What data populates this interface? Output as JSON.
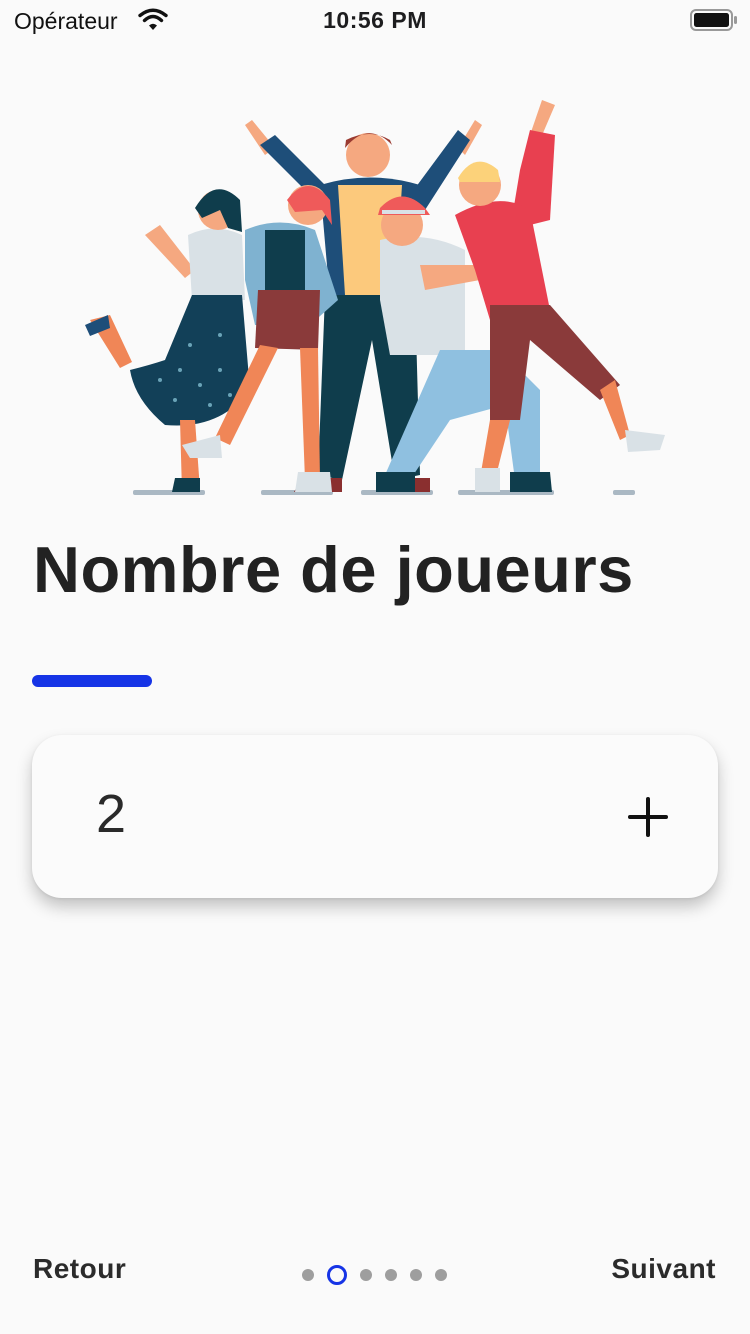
{
  "status_bar": {
    "carrier": "Opérateur",
    "time": "10:56 PM",
    "icons": [
      "wifi-icon",
      "battery-icon"
    ]
  },
  "hero": {
    "illustration": "group-of-friends-celebrating-illustration"
  },
  "page": {
    "title": "Nombre de joueurs",
    "accent_color": "#1634e6"
  },
  "stepper": {
    "value": "2",
    "increment_icon": "plus-icon"
  },
  "footer": {
    "back_label": "Retour",
    "next_label": "Suivant",
    "pagination": {
      "total": 6,
      "current": 2
    }
  }
}
